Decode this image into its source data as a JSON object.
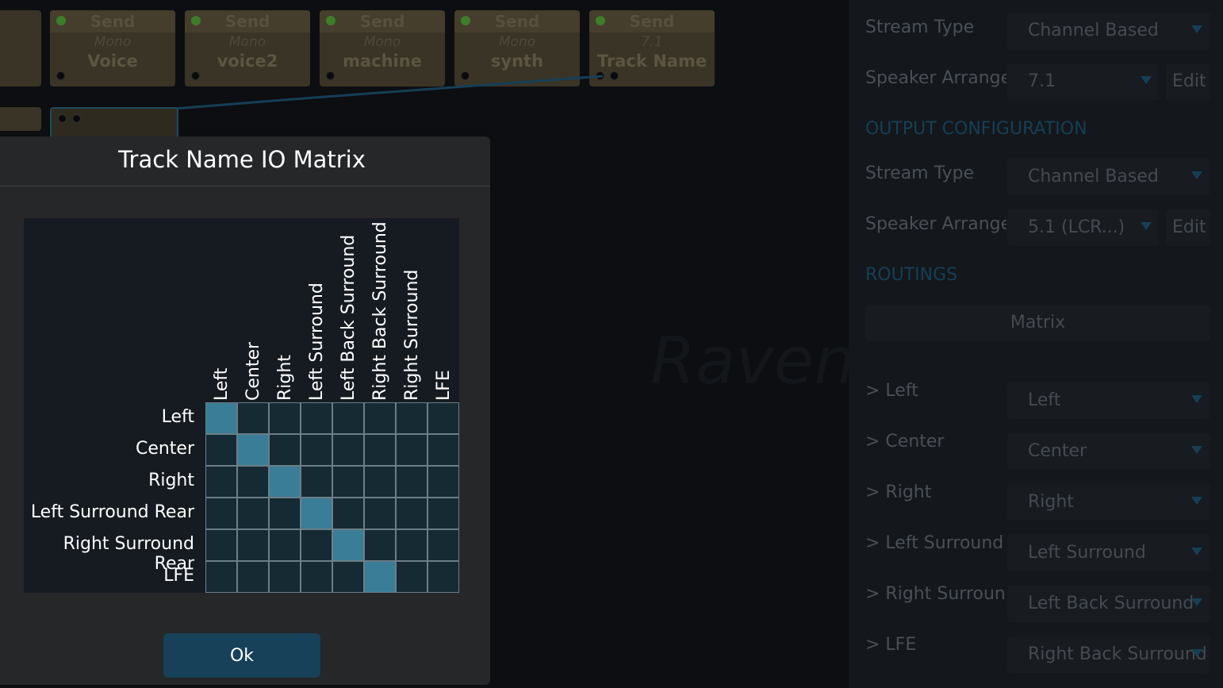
{
  "graph": {
    "nodes": [
      {
        "header": "Send",
        "format": "Mono",
        "name": "Voice"
      },
      {
        "header": "Send",
        "format": "Mono",
        "name": "voice2"
      },
      {
        "header": "Send",
        "format": "Mono",
        "name": "machine"
      },
      {
        "header": "Send",
        "format": "Mono",
        "name": "synth"
      },
      {
        "header": "Send",
        "format": "7.1",
        "name": "Track Name"
      }
    ]
  },
  "panel": {
    "input": {
      "stream_type_label": "Stream Type",
      "stream_type_value": "Channel Based",
      "speaker_label": "Speaker Arrange",
      "speaker_value": "7.1",
      "edit_label": "Edit"
    },
    "output_section": "OUTPUT CONFIGURATION",
    "output": {
      "stream_type_label": "Stream Type",
      "stream_type_value": "Channel Based",
      "speaker_label": "Speaker Arrange",
      "speaker_value": "5.1 (LCR...)",
      "edit_label": "Edit"
    },
    "routings_section": "ROUTINGS",
    "matrix_button": "Matrix",
    "routings": [
      {
        "label": "> Left",
        "value": "Left"
      },
      {
        "label": "> Center",
        "value": "Center"
      },
      {
        "label": "> Right",
        "value": "Right"
      },
      {
        "label": "> Left Surround",
        "value": "Left Surround"
      },
      {
        "label": "> Right Surroun",
        "value": "Left Back Surround"
      },
      {
        "label": "> LFE",
        "value": "Right Back Surround"
      }
    ]
  },
  "dialog": {
    "title": "Track Name IO Matrix",
    "columns": [
      "Left",
      "Center",
      "Right",
      "Left Surround",
      "Left Back Surround",
      "Right Back Surround",
      "Right Surround",
      "LFE"
    ],
    "rows": [
      "Left",
      "Center",
      "Right",
      "Left Surround Rear",
      "Right Surround Rear",
      "LFE"
    ],
    "active_column_per_row": [
      0,
      1,
      2,
      3,
      4,
      5
    ],
    "ok_label": "Ok"
  }
}
